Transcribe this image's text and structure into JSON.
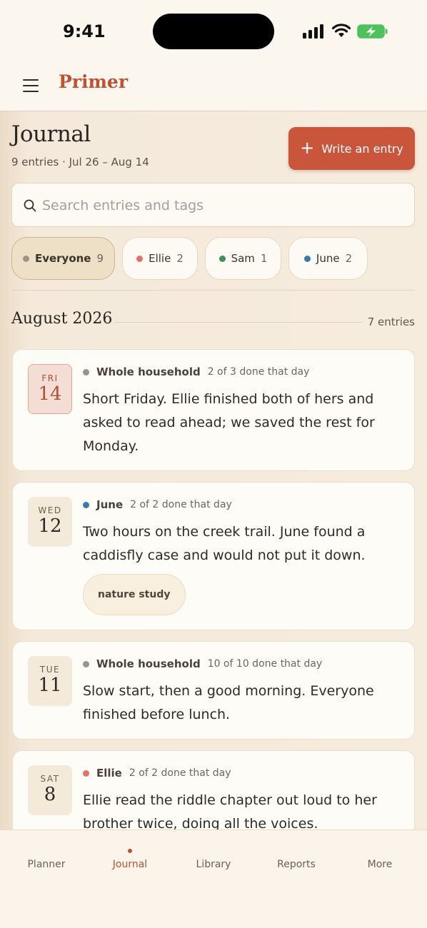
{
  "status_bar": {
    "time": "9:41"
  },
  "header": {
    "brand": "Primer"
  },
  "page": {
    "title": "Journal",
    "subtitle": "9 entries · Jul 26 – Aug 14",
    "write_button": "Write an entry"
  },
  "search": {
    "placeholder": "Search entries and tags",
    "value": ""
  },
  "filters": [
    {
      "label": "Everyone",
      "count": "9",
      "color": "#9b938a",
      "active": true
    },
    {
      "label": "Ellie",
      "count": "2",
      "color": "#e0736a",
      "active": false
    },
    {
      "label": "Sam",
      "count": "1",
      "color": "#3f8f5c",
      "active": false
    },
    {
      "label": "June",
      "count": "2",
      "color": "#3b78ab",
      "active": false
    }
  ],
  "month": {
    "title": "August 2026",
    "count": "7 entries"
  },
  "entries": [
    {
      "dow": "FRI",
      "day": "14",
      "highlight": true,
      "who": "Whole household",
      "who_color": "#9b938a",
      "done": "2 of 3 done that day",
      "text": "Short Friday. Ellie finished both of hers and asked to read ahead; we saved the rest for Monday."
    },
    {
      "dow": "WED",
      "day": "12",
      "highlight": false,
      "who": "June",
      "who_color": "#3b78ab",
      "done": "2 of 2 done that day",
      "text": "Two hours on the creek trail. June found a caddisfly case and would not put it down.",
      "tag": "nature study"
    },
    {
      "dow": "TUE",
      "day": "11",
      "highlight": false,
      "who": "Whole household",
      "who_color": "#9b938a",
      "done": "10 of 10 done that day",
      "text": "Slow start, then a good morning. Everyone finished before lunch."
    },
    {
      "dow": "SAT",
      "day": "8",
      "highlight": false,
      "who": "Ellie",
      "who_color": "#e0736a",
      "done": "2 of 2 done that day",
      "text": "Ellie read the riddle chapter out loud to her brother twice, doing all the voices."
    }
  ],
  "nav": [
    {
      "label": "Planner",
      "active": false
    },
    {
      "label": "Journal",
      "active": true
    },
    {
      "label": "Library",
      "active": false
    },
    {
      "label": "Reports",
      "active": false
    },
    {
      "label": "More",
      "active": false
    }
  ],
  "colors": {
    "accent": "#c9553a",
    "brand": "#c0502f",
    "background": "#f4e9da"
  }
}
